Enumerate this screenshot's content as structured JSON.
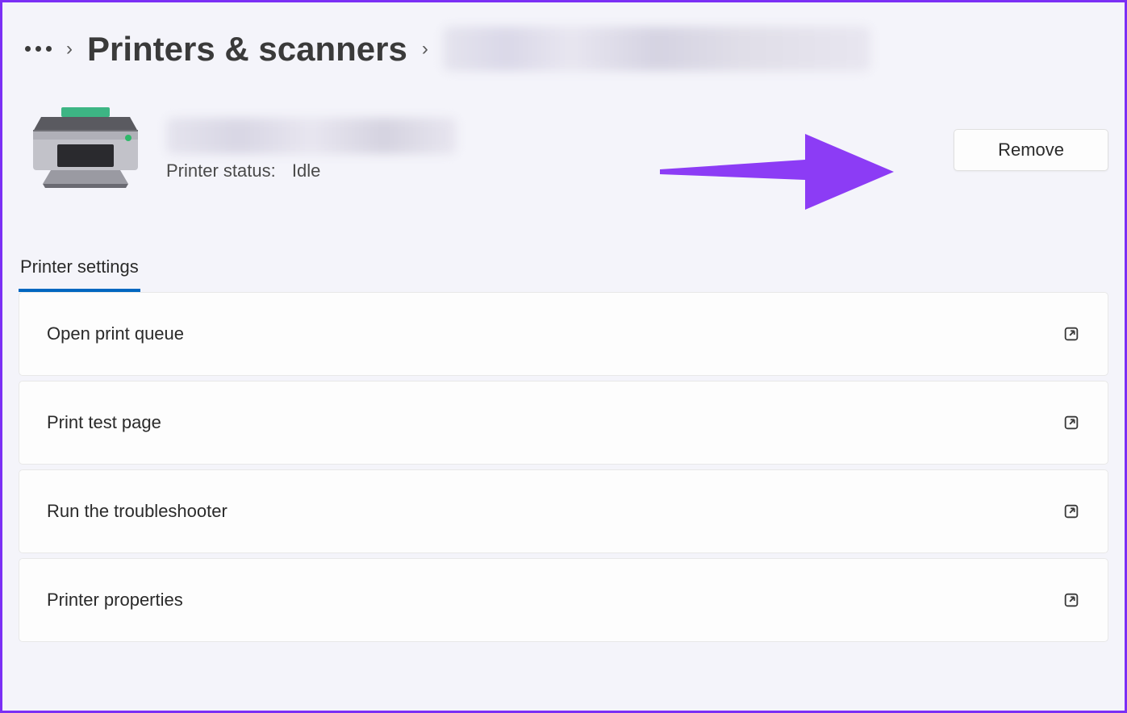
{
  "breadcrumb": {
    "category": "Printers & scanners"
  },
  "printer": {
    "status_label": "Printer status:",
    "status_value": "Idle",
    "remove_label": "Remove"
  },
  "tab": {
    "label": "Printer settings"
  },
  "settings": [
    {
      "label": "Open print queue"
    },
    {
      "label": "Print test page"
    },
    {
      "label": "Run the troubleshooter"
    },
    {
      "label": "Printer properties"
    }
  ],
  "colors": {
    "accent": "#0067c0",
    "arrow": "#8c3cf5",
    "border": "#7b2ff5"
  }
}
